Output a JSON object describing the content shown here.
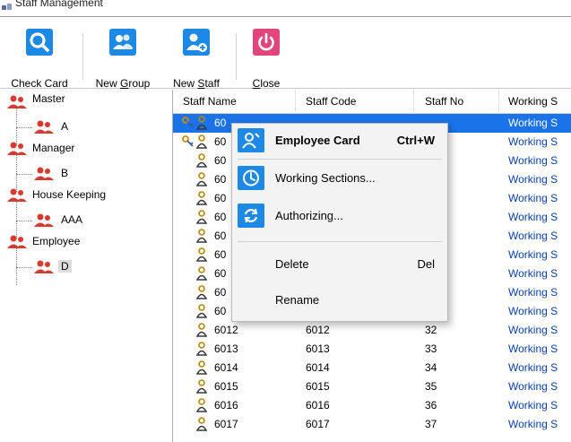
{
  "window": {
    "title": "Staff Management"
  },
  "toolbar": {
    "check_card": "Check Card",
    "new_group_prefix": "New ",
    "new_group_accel": "G",
    "new_group_suffix": "roup",
    "new_staff_prefix": "New ",
    "new_staff_accel": "S",
    "new_staff_suffix": "taff",
    "close_accel": "C",
    "close_suffix": "lose"
  },
  "tree": [
    {
      "label": "Master"
    },
    {
      "label": "A"
    },
    {
      "label": "Manager"
    },
    {
      "label": "B"
    },
    {
      "label": "House Keeping"
    },
    {
      "label": "AAA"
    },
    {
      "label": "Employee"
    },
    {
      "label": "D"
    }
  ],
  "grid": {
    "columns": [
      "Staff Name",
      "Staff Code",
      "Staff No",
      "Working S"
    ],
    "rows": [
      {
        "name": "60",
        "code": "",
        "no": "",
        "ws": "Working S"
      },
      {
        "name": "60",
        "code": "",
        "no": "",
        "ws": "Working S"
      },
      {
        "name": "60",
        "code": "",
        "no": "",
        "ws": "Working S"
      },
      {
        "name": "60",
        "code": "",
        "no": "",
        "ws": "Working S"
      },
      {
        "name": "60",
        "code": "",
        "no": "",
        "ws": "Working S"
      },
      {
        "name": "60",
        "code": "",
        "no": "",
        "ws": "Working S"
      },
      {
        "name": "60",
        "code": "",
        "no": "",
        "ws": "Working S"
      },
      {
        "name": "60",
        "code": "",
        "no": "",
        "ws": "Working S"
      },
      {
        "name": "60",
        "code": "",
        "no": "",
        "ws": "Working S"
      },
      {
        "name": "60",
        "code": "",
        "no": "",
        "ws": "Working S"
      },
      {
        "name": "60",
        "code": "",
        "no": "",
        "ws": "Working S"
      },
      {
        "name": "6012",
        "code": "6012",
        "no": "32",
        "ws": "Working S"
      },
      {
        "name": "6013",
        "code": "6013",
        "no": "33",
        "ws": "Working S"
      },
      {
        "name": "6014",
        "code": "6014",
        "no": "34",
        "ws": "Working S"
      },
      {
        "name": "6015",
        "code": "6015",
        "no": "35",
        "ws": "Working S"
      },
      {
        "name": "6016",
        "code": "6016",
        "no": "36",
        "ws": "Working S"
      },
      {
        "name": "6017",
        "code": "6017",
        "no": "37",
        "ws": "Working S"
      }
    ]
  },
  "context_menu": {
    "employee_card": "Employee Card",
    "employee_card_shortcut": "Ctrl+W",
    "working_sections": "Working Sections...",
    "authorizing": "Authorizing...",
    "delete": "Delete",
    "delete_shortcut": "Del",
    "rename": "Rename"
  },
  "colors": {
    "accent": "#1e88e5",
    "close_button": "#e0457b",
    "group_icon": "#d63b2f",
    "highlight_box": "#e8343a",
    "selection": "#1a73e8"
  }
}
